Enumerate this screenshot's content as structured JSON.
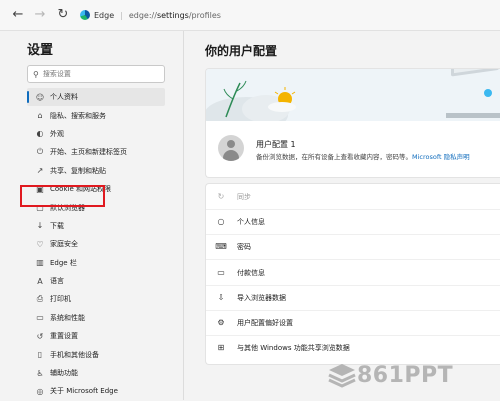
{
  "browser": {
    "back_icon": "back-arrow-icon",
    "forward_icon": "forward-arrow-icon",
    "refresh_icon": "refresh-icon",
    "site_label": "Edge",
    "separator": "|",
    "url_prefix": "edge://",
    "url_path": "settings",
    "url_suffix": "/profiles"
  },
  "sidebar": {
    "title": "设置",
    "search_placeholder": "搜索设置",
    "items": [
      {
        "label": "个人资料",
        "icon": "profile-icon",
        "active": true
      },
      {
        "label": "隐私、搜索和服务",
        "icon": "lock-icon"
      },
      {
        "label": "外观",
        "icon": "appearance-icon"
      },
      {
        "label": "开始、主页和新建标签页",
        "icon": "power-icon"
      },
      {
        "label": "共享、复制和粘贴",
        "icon": "share-icon"
      },
      {
        "label": "Cookie 和网站权限",
        "icon": "cookie-icon"
      },
      {
        "label": "默认浏览器",
        "icon": "browser-icon"
      },
      {
        "label": "下载",
        "icon": "download-icon"
      },
      {
        "label": "家庭安全",
        "icon": "family-icon"
      },
      {
        "label": "Edge 栏",
        "icon": "sidebar-icon"
      },
      {
        "label": "语言",
        "icon": "language-icon"
      },
      {
        "label": "打印机",
        "icon": "printer-icon"
      },
      {
        "label": "系统和性能",
        "icon": "system-icon"
      },
      {
        "label": "重置设置",
        "icon": "reset-icon"
      },
      {
        "label": "手机和其他设备",
        "icon": "phone-icon"
      },
      {
        "label": "辅助功能",
        "icon": "accessibility-icon"
      },
      {
        "label": "关于 Microsoft Edge",
        "icon": "edge-icon"
      }
    ]
  },
  "main": {
    "title": "你的用户配置",
    "profile": {
      "name": "用户配置 1",
      "description": "备份浏览数据，在所有设备上查看收藏内容，密码等。",
      "link": "Microsoft 隐私声明"
    },
    "rows": [
      {
        "label": "同步",
        "icon": "sync-icon",
        "dim": true
      },
      {
        "label": "个人信息",
        "icon": "person-icon"
      },
      {
        "label": "密码",
        "icon": "key-icon"
      },
      {
        "label": "付款信息",
        "icon": "card-icon"
      },
      {
        "label": "导入浏览器数据",
        "icon": "import-icon"
      },
      {
        "label": "用户配置偏好设置",
        "icon": "profile-settings-icon"
      },
      {
        "label": "与其他 Windows 功能共享浏览数据",
        "icon": "windows-icon"
      }
    ]
  },
  "watermark": {
    "text": "861PPT"
  },
  "colors": {
    "accent": "#0f6cbd",
    "highlight": "#e0191f",
    "background": "#f3f3f3"
  }
}
